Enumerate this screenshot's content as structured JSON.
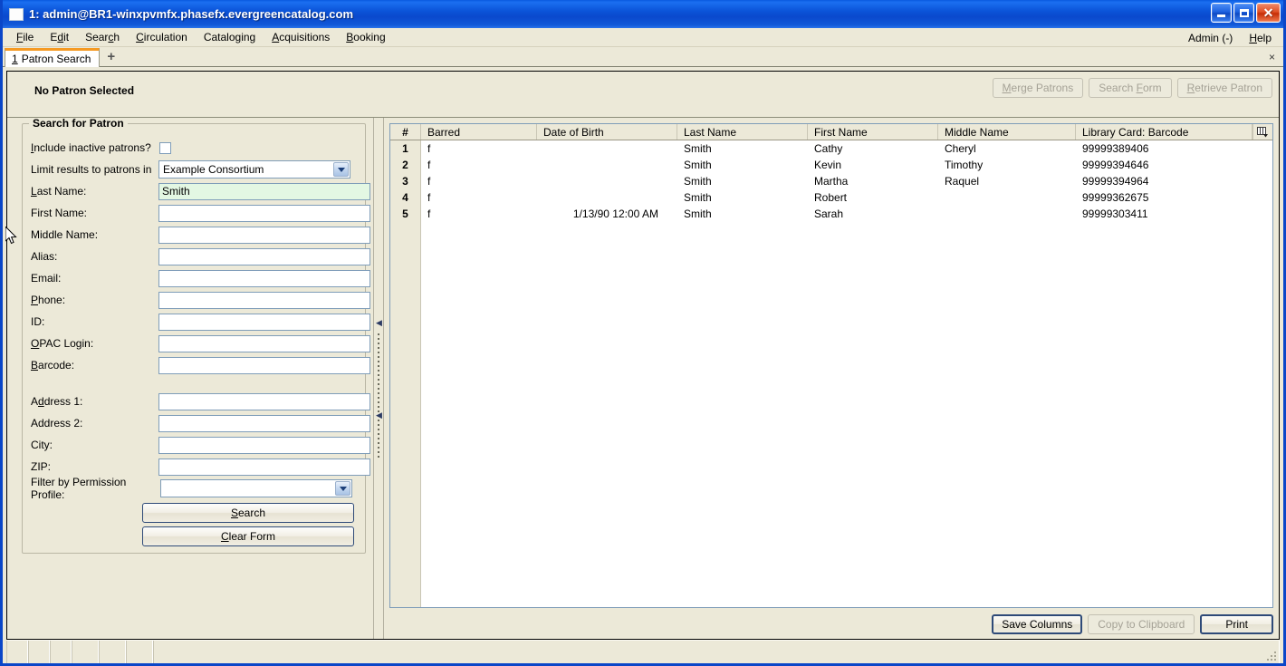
{
  "window": {
    "title": "1: admin@BR1-winxpvmfx.phasefx.evergreencatalog.com",
    "icon": "window-icon",
    "minimize_label": "",
    "maximize_label": "",
    "close_label": "✕"
  },
  "menubar": {
    "items": [
      {
        "label": "File",
        "mnemonic": "F"
      },
      {
        "label": "Edit",
        "mnemonic": "E"
      },
      {
        "label": "Search",
        "mnemonic": "c"
      },
      {
        "label": "Circulation",
        "mnemonic": "C"
      },
      {
        "label": "Cataloging",
        "mnemonic": "g"
      },
      {
        "label": "Acquisitions",
        "mnemonic": "A"
      },
      {
        "label": "Booking",
        "mnemonic": "B"
      }
    ],
    "right_items": [
      {
        "label": "Admin (-)",
        "mnemonic": ""
      },
      {
        "label": "Help",
        "mnemonic": "H"
      }
    ]
  },
  "tabs": {
    "active": {
      "index": "1",
      "label": "Patron Search"
    },
    "add_label": "+",
    "close_label": "×"
  },
  "banner": {
    "patron_status": "No Patron Selected",
    "buttons": [
      {
        "label": "Merge Patrons",
        "disabled": true
      },
      {
        "label": "Search Form",
        "disabled": true
      },
      {
        "label": "Retrieve Patron",
        "disabled": true
      }
    ]
  },
  "search_form": {
    "title": "Search for Patron",
    "include_inactive": {
      "label": "Include inactive patrons?",
      "checked": false
    },
    "limit_results": {
      "label": "Limit results to patrons in",
      "value": "Example Consortium",
      "options": [
        "Example Consortium"
      ]
    },
    "fields": [
      {
        "label": "Last Name:",
        "value": "Smith",
        "placeholder": "",
        "focused": true
      },
      {
        "label": "First Name:",
        "value": "",
        "placeholder": "",
        "focused": false
      },
      {
        "label": "Middle Name:",
        "value": "",
        "placeholder": "",
        "focused": false
      },
      {
        "label": "Alias:",
        "value": "",
        "placeholder": "",
        "focused": false
      },
      {
        "label": "Email:",
        "value": "",
        "placeholder": "",
        "focused": false
      },
      {
        "label": "Phone:",
        "value": "",
        "placeholder": "",
        "focused": false
      },
      {
        "label": "ID:",
        "value": "",
        "placeholder": "",
        "focused": false
      },
      {
        "label": "OPAC Login:",
        "value": "",
        "placeholder": "",
        "focused": false
      },
      {
        "label": "Barcode:",
        "value": "",
        "placeholder": "",
        "focused": false
      }
    ],
    "address_fields": [
      {
        "label": "Address 1:",
        "value": "",
        "placeholder": ""
      },
      {
        "label": "Address 2:",
        "value": "",
        "placeholder": ""
      },
      {
        "label": "City:",
        "value": "",
        "placeholder": ""
      },
      {
        "label": "ZIP:",
        "value": "",
        "placeholder": ""
      }
    ],
    "permission_profile": {
      "label": "Filter by Permission Profile:",
      "value": "",
      "options": []
    },
    "search_button": "Search",
    "clear_button": "Clear Form"
  },
  "results": {
    "columns": [
      {
        "label": "#",
        "width": 34
      },
      {
        "label": "Barred",
        "width": 128
      },
      {
        "label": "Date of Birth",
        "width": 155
      },
      {
        "label": "Last Name",
        "width": 144
      },
      {
        "label": "First Name",
        "width": 144
      },
      {
        "label": "Middle Name",
        "width": 152
      },
      {
        "label": "Library Card: Barcode",
        "width": 195
      }
    ],
    "column_picker_icon": "column-picker-icon",
    "rows": [
      {
        "num": "1",
        "barred": "f",
        "dob": "",
        "last": "Smith",
        "first": "Cathy",
        "middle": "Cheryl",
        "barcode": "99999389406"
      },
      {
        "num": "2",
        "barred": "f",
        "dob": "",
        "last": "Smith",
        "first": "Kevin",
        "middle": "Timothy",
        "barcode": "99999394646"
      },
      {
        "num": "3",
        "barred": "f",
        "dob": "",
        "last": "Smith",
        "first": "Martha",
        "middle": "Raquel",
        "barcode": "99999394964"
      },
      {
        "num": "4",
        "barred": "f",
        "dob": "",
        "last": "Smith",
        "first": "Robert",
        "middle": "",
        "barcode": "99999362675"
      },
      {
        "num": "5",
        "barred": "f",
        "dob": "1/13/90 12:00 AM",
        "last": "Smith",
        "first": "Sarah",
        "middle": "",
        "barcode": "99999303411"
      }
    ],
    "footer_buttons": [
      {
        "label": "Save Columns",
        "disabled": false,
        "default": true
      },
      {
        "label": "Copy to Clipboard",
        "disabled": true,
        "default": false
      },
      {
        "label": "Print",
        "disabled": false,
        "default": true
      }
    ]
  },
  "colors": {
    "titlebar": "#0a49cd",
    "chrome": "#ece9d8",
    "active_tab_accent": "#f59a23",
    "field_border": "#7f9db9",
    "focused_field_bg": "#e3f7e3",
    "default_button_border": "#2e4a78"
  }
}
